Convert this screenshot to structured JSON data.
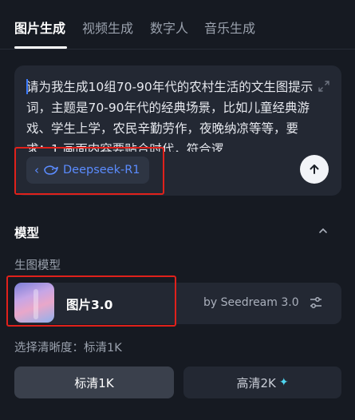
{
  "tabs": [
    {
      "label": "图片生成",
      "active": true
    },
    {
      "label": "视频生成",
      "active": false
    },
    {
      "label": "数字人",
      "active": false
    },
    {
      "label": "音乐生成",
      "active": false
    }
  ],
  "prompt": {
    "text": "请为我生成10组70-90年代的农村生活的文生图提示词，主题是70-90年代的经典场景，比如儿童经典游戏、学生上学，农民辛勤劳作，夜晚纳凉等等，要求：1.画面内容要贴合时代，符合逻"
  },
  "model_chip": {
    "label": "Deepseek-R1"
  },
  "model_section": {
    "title": "模型",
    "sub_label": "生图模型",
    "model_name": "图片3.0",
    "model_by": "by Seedream 3.0"
  },
  "resolution": {
    "label": "选择清晰度：标清1K",
    "options": [
      {
        "label": "标清1K",
        "active": true
      },
      {
        "label": "高清2K",
        "active": false
      }
    ]
  },
  "colors": {
    "accent_blue": "#5b8cff",
    "highlight_red": "#e0211b",
    "sparkle": "#4fd6f0"
  }
}
